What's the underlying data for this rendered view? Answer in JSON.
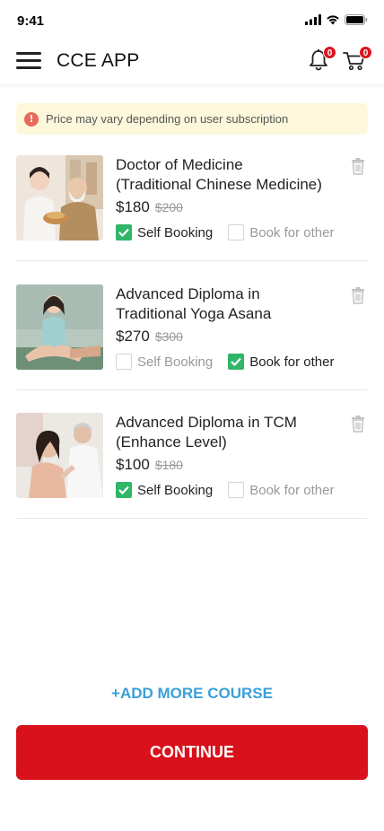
{
  "status_bar": {
    "time": "9:41"
  },
  "header": {
    "title": "CCE APP",
    "notifications_count": "0",
    "cart_count": "0"
  },
  "notice": {
    "text": "Price may vary depending on user subscription"
  },
  "courses": [
    {
      "title_line1": "Doctor of Medicine",
      "title_line2": "(Traditional Chinese Medicine)",
      "price": "$180",
      "old_price": "$200",
      "self_booking_label": "Self Booking",
      "book_other_label": "Book for other",
      "self_booking_checked": true,
      "book_other_checked": false
    },
    {
      "title_line1": "Advanced Diploma in",
      "title_line2": "Traditional Yoga Asana",
      "price": "$270",
      "old_price": "$300",
      "self_booking_label": "Self Booking",
      "book_other_label": "Book for other",
      "self_booking_checked": false,
      "book_other_checked": true
    },
    {
      "title_line1": "Advanced Diploma in TCM",
      "title_line2": "(Enhance Level)",
      "price": "$100",
      "old_price": "$180",
      "self_booking_label": "Self Booking",
      "book_other_label": "Book for other",
      "self_booking_checked": true,
      "book_other_checked": false
    }
  ],
  "actions": {
    "add_more_label": "+ADD MORE COURSE",
    "continue_label": "CONTINUE"
  },
  "colors": {
    "brand_red": "#d8111b",
    "check_green": "#2fb669",
    "link_blue": "#3b9fd8",
    "notice_bg": "#fdf7dc"
  }
}
